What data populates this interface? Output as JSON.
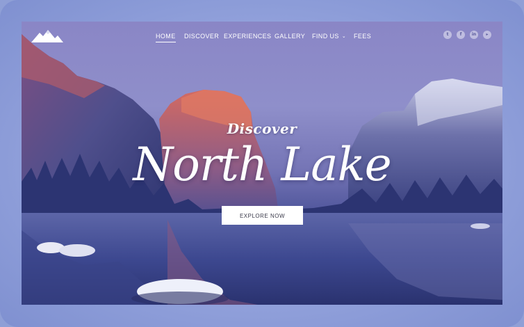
{
  "nav": {
    "items": [
      {
        "label": "HOME"
      },
      {
        "label": "DISCOVER"
      },
      {
        "label": "EXPERIENCES"
      },
      {
        "label": "GALLERY"
      },
      {
        "label": "FIND US"
      },
      {
        "label": "FEES"
      }
    ],
    "active_item": "HOME"
  },
  "social": [
    {
      "icon": "twitter-icon",
      "glyph": "t"
    },
    {
      "icon": "facebook-icon",
      "glyph": "f"
    },
    {
      "icon": "linkedin-icon",
      "glyph": "in"
    },
    {
      "icon": "youtube-icon",
      "glyph": "▸"
    }
  ],
  "hero": {
    "kicker": "Discover",
    "title": "North Lake",
    "cta_label": "EXPLORE NOW"
  },
  "colors": {
    "frame": "#8f9fd6",
    "sky": "#8a86c6",
    "water": "#2f3877",
    "cta_bg": "#ffffff"
  }
}
